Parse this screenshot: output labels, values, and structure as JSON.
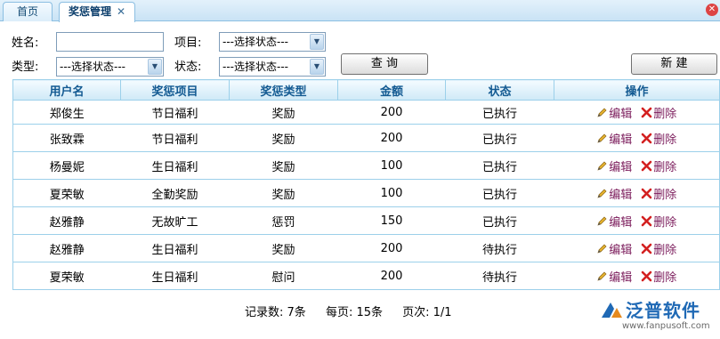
{
  "tabs": [
    {
      "label": "首页"
    },
    {
      "label": "奖惩管理"
    }
  ],
  "filters": {
    "name_label": "姓名:",
    "name_value": "",
    "item_label": "项目:",
    "item_value": "---选择状态---",
    "type_label": "类型:",
    "type_value": "---选择状态---",
    "status_label": "状态:",
    "status_value": "---选择状态---",
    "query_button": "查 询",
    "new_button": "新 建"
  },
  "table": {
    "columns": [
      "用户名",
      "奖惩项目",
      "奖惩类型",
      "金额",
      "状态",
      "操作"
    ],
    "edit_label": "编辑",
    "delete_label": "删除",
    "rows": [
      [
        "郑俊生",
        "节日福利",
        "奖励",
        "200",
        "已执行"
      ],
      [
        "张致霖",
        "节日福利",
        "奖励",
        "200",
        "已执行"
      ],
      [
        "杨曼妮",
        "生日福利",
        "奖励",
        "100",
        "已执行"
      ],
      [
        "夏荣敏",
        "全勤奖励",
        "奖励",
        "100",
        "已执行"
      ],
      [
        "赵雅静",
        "无故旷工",
        "惩罚",
        "150",
        "已执行"
      ],
      [
        "赵雅静",
        "生日福利",
        "奖励",
        "200",
        "待执行"
      ],
      [
        "夏荣敏",
        "生日福利",
        "慰问",
        "200",
        "待执行"
      ]
    ]
  },
  "footer": {
    "records": "记录数: 7条",
    "per_page": "每页: 15条",
    "page": "页次: 1/1"
  },
  "logo": {
    "name": "泛普软件",
    "url": "www.fanpusoft.com"
  },
  "colors": {
    "header_text": "#135a92",
    "action_text": "#7a1a5a",
    "grid_border": "#9cd0ea"
  }
}
